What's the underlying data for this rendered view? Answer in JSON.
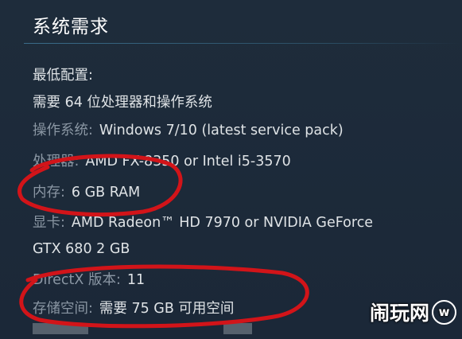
{
  "section": {
    "title": "系统需求"
  },
  "minimum": {
    "heading": "最低配置:",
    "note": "需要 64 位处理器和操作系统",
    "rows": [
      {
        "label": "操作系统:",
        "value": "Windows 7/10 (latest service pack)"
      },
      {
        "label": "处理器:",
        "value": "AMD FX-8350 or Intel i5-3570"
      },
      {
        "label": "内存:",
        "value": "6 GB RAM"
      },
      {
        "label": "显卡:",
        "value": "AMD Radeon™ HD 7970 or NVIDIA GeForce"
      },
      {
        "label": "",
        "value": "GTX 680 2 GB"
      },
      {
        "label": "DirectX 版本:",
        "value": "11"
      },
      {
        "label": "存储空间:",
        "value": "需要 75 GB 可用空间"
      }
    ]
  },
  "annotation": {
    "color": "#d21419"
  },
  "watermark": {
    "text": "闹玩网",
    "logo": "w"
  }
}
